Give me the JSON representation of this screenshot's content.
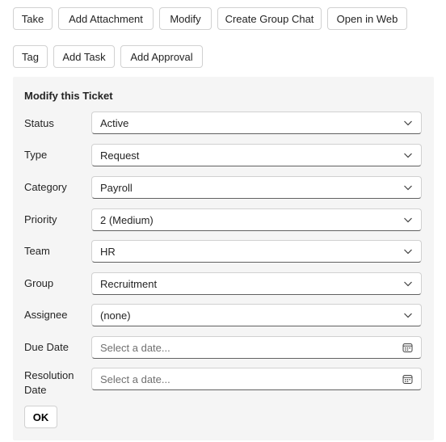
{
  "toolbar": {
    "row1": [
      "Take",
      "Add Attachment",
      "Modify",
      "Create Group Chat",
      "Open in Web"
    ],
    "row2": [
      "Tag",
      "Add Task",
      "Add Approval"
    ]
  },
  "form": {
    "title": "Modify this Ticket",
    "fields": [
      {
        "label": "Status",
        "value": "Active",
        "kind": "dropdown"
      },
      {
        "label": "Type",
        "value": "Request",
        "kind": "dropdown"
      },
      {
        "label": "Category",
        "value": "Payroll",
        "kind": "dropdown"
      },
      {
        "label": "Priority",
        "value": "2 (Medium)",
        "kind": "dropdown"
      },
      {
        "label": "Team",
        "value": "HR",
        "kind": "dropdown"
      },
      {
        "label": "Group",
        "value": "Recruitment",
        "kind": "dropdown"
      },
      {
        "label": "Assignee",
        "value": "(none)",
        "kind": "dropdown"
      },
      {
        "label": "Due Date",
        "placeholder": "Select a date...",
        "kind": "date"
      },
      {
        "label": "Resolution Date",
        "placeholder": "Select a date...",
        "kind": "date"
      }
    ],
    "ok_label": "OK"
  },
  "icons": {
    "dropdown": "chevron-down-icon",
    "date": "calendar-icon"
  },
  "colors": {
    "panel_bg": "#f5f5f5",
    "border": "#d1d1d1",
    "text": "#242424",
    "placeholder": "#707070"
  }
}
